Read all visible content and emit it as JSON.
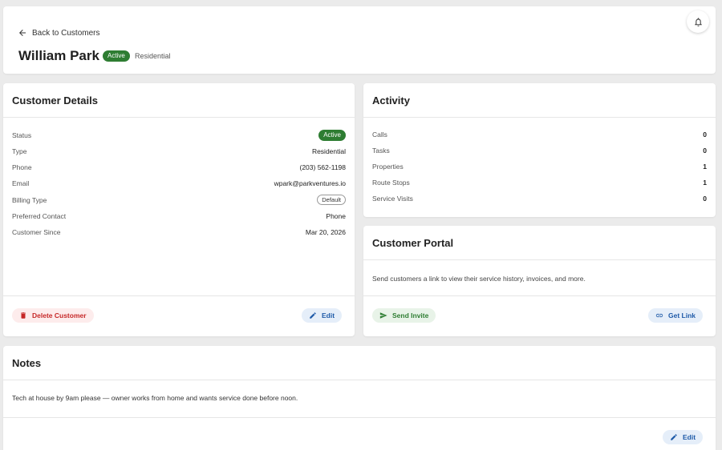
{
  "header": {
    "back_label": "Back to Customers",
    "customer_name": "William Park",
    "status_badge": "Active",
    "customer_type": "Residential"
  },
  "details": {
    "title": "Customer Details",
    "rows": [
      {
        "label": "Status",
        "value": "Active"
      },
      {
        "label": "Type",
        "value": "Residential"
      },
      {
        "label": "Phone",
        "value": "(203) 562-1198"
      },
      {
        "label": "Email",
        "value": "wpark@parkventures.io"
      },
      {
        "label": "Billing Type",
        "value": "Default"
      },
      {
        "label": "Preferred Contact",
        "value": "Phone"
      },
      {
        "label": "Customer Since",
        "value": "Mar 20, 2026"
      }
    ],
    "delete_label": "Delete Customer",
    "edit_label": "Edit"
  },
  "activity": {
    "title": "Activity",
    "rows": [
      {
        "label": "Calls",
        "value": "0"
      },
      {
        "label": "Tasks",
        "value": "0"
      },
      {
        "label": "Properties",
        "value": "1"
      },
      {
        "label": "Route Stops",
        "value": "1"
      },
      {
        "label": "Service Visits",
        "value": "0"
      }
    ]
  },
  "portal": {
    "title": "Customer Portal",
    "description": "Send customers a link to view their service history, invoices, and more.",
    "send_label": "Send Invite",
    "link_label": "Get Link"
  },
  "notes": {
    "title": "Notes",
    "text": "Tech at house by 9am please — owner works from home and wants service done before noon.",
    "edit_label": "Edit"
  },
  "colors": {
    "active_green": "#2e7d32",
    "danger_red": "#c62828",
    "link_blue": "#1e5aa8"
  },
  "icons": {
    "back": "arrow-left-icon",
    "bell": "bell-icon",
    "delete": "trash-icon",
    "edit": "pencil-icon",
    "send": "send-icon",
    "link": "link-icon"
  }
}
